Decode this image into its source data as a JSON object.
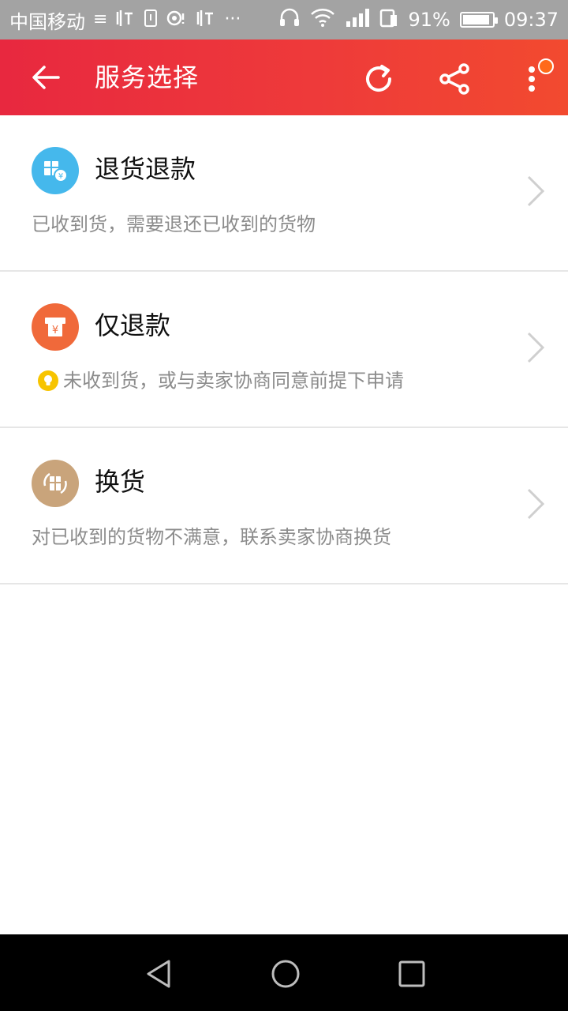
{
  "status_bar": {
    "carrier": "中国移动",
    "battery": "91%",
    "time": "09:37",
    "battery_level": 0.91,
    "icons": [
      "notification-icon",
      "listen-icon",
      "sim-icon",
      "location-icon",
      "headphones-icon",
      "wifi-icon",
      "signal-icon"
    ]
  },
  "app_bar": {
    "title": "服务选择",
    "back_icon": "arrow-left-icon",
    "refresh_icon": "refresh-icon",
    "share_icon": "share-icon",
    "more_icon": "more-vertical-icon",
    "badge_color": "#ff6a1a"
  },
  "options": [
    {
      "title": "退货退款",
      "description": "已收到货，需要退还已收到的货物",
      "icon": "return-refund-icon",
      "icon_color": "#45b8ec"
    },
    {
      "title": "仅退款",
      "description": "未收到货，或与卖家协商同意前提下申请",
      "icon": "refund-only-icon",
      "icon_color": "#f0693a",
      "tip_icon": "lightbulb-icon"
    },
    {
      "title": "换货",
      "description": "对已收到的货物不满意，联系卖家协商换货",
      "icon": "exchange-icon",
      "icon_color": "#c9a47b"
    }
  ],
  "colors": {
    "app_bar_start": "#e8283f",
    "app_bar_end": "#f24a2f",
    "desc_text": "#8c8c8c",
    "divider": "#e6e6e6"
  }
}
